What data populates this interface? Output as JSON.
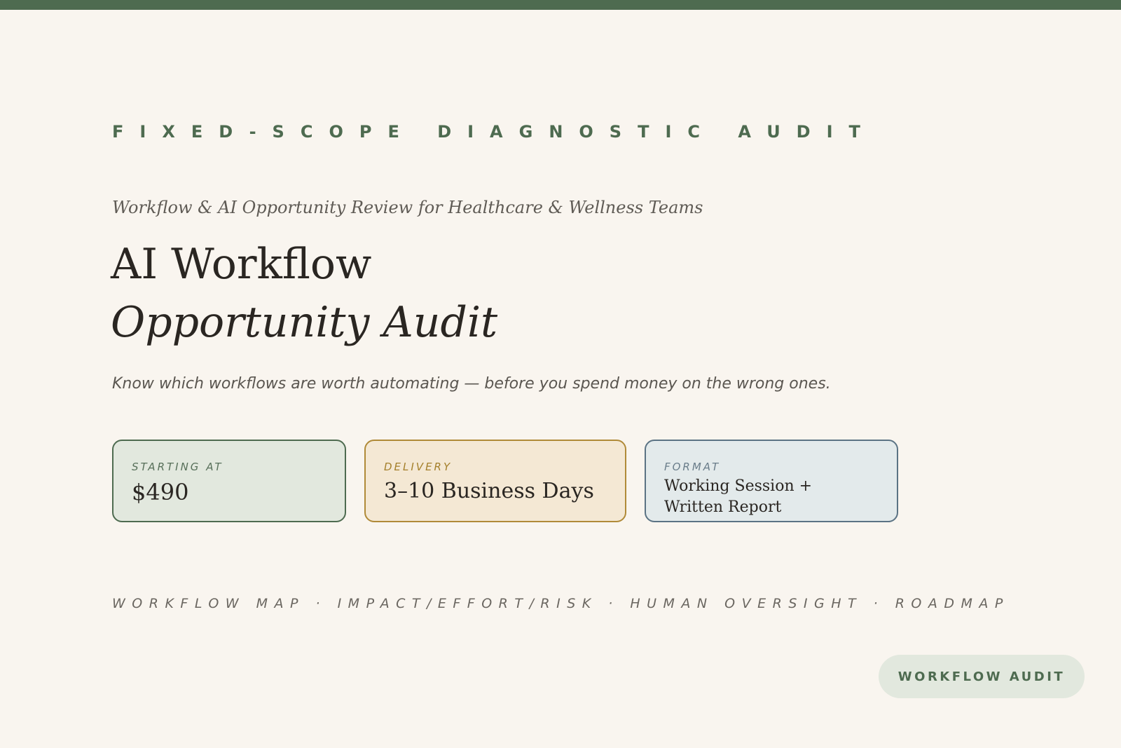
{
  "colors": {
    "accent_green": "#4e6b50",
    "accent_gold": "#b08a38",
    "accent_slate": "#5b7384",
    "background": "#f9f5ef",
    "text_dark": "#2a2622"
  },
  "header": {
    "eyebrow": "FIXED-SCOPE DIAGNOSTIC AUDIT",
    "subtitle": "Workflow & AI Opportunity Review for Healthcare & Wellness Teams",
    "title_line1": "AI Workflow",
    "title_line2": "Opportunity Audit",
    "tagline": "Know which workflows are worth automating — before you spend money on the wrong ones."
  },
  "cards": {
    "price": {
      "label": "STARTING AT",
      "value": "$490"
    },
    "delivery": {
      "label": "DELIVERY",
      "value": "3–10 Business Days"
    },
    "format": {
      "label": "FORMAT",
      "value": "Working Session + Written Report"
    }
  },
  "footer": {
    "deliverables": "WORKFLOW MAP · IMPACT/EFFORT/RISK · HUMAN OVERSIGHT · ROADMAP",
    "badge": "WORKFLOW AUDIT"
  }
}
